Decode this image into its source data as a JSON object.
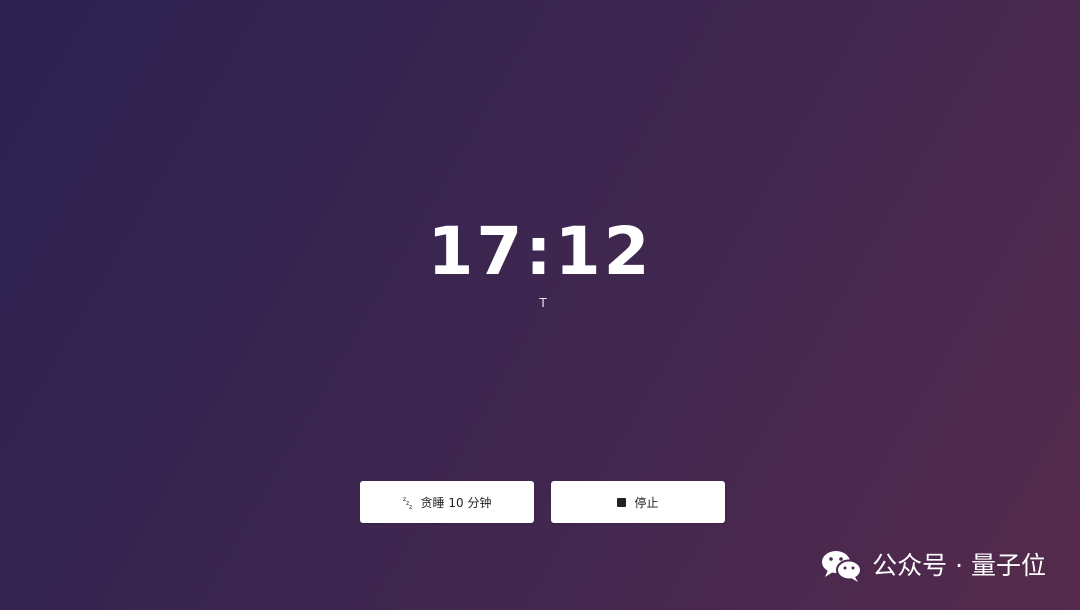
{
  "alarm": {
    "time": "17:12",
    "label": "T"
  },
  "buttons": {
    "snooze_label": "贪睡 10 分钟",
    "snooze_icon": "snooze-zz-icon",
    "stop_label": "停止",
    "stop_icon": "stop-square-icon"
  },
  "watermark": {
    "icon": "wechat-icon",
    "text": "公众号 · 量子位"
  },
  "colors": {
    "background_start": "#2a2150",
    "background_end": "#552a4c",
    "button_bg": "#ffffff",
    "text_primary": "#ffffff"
  }
}
